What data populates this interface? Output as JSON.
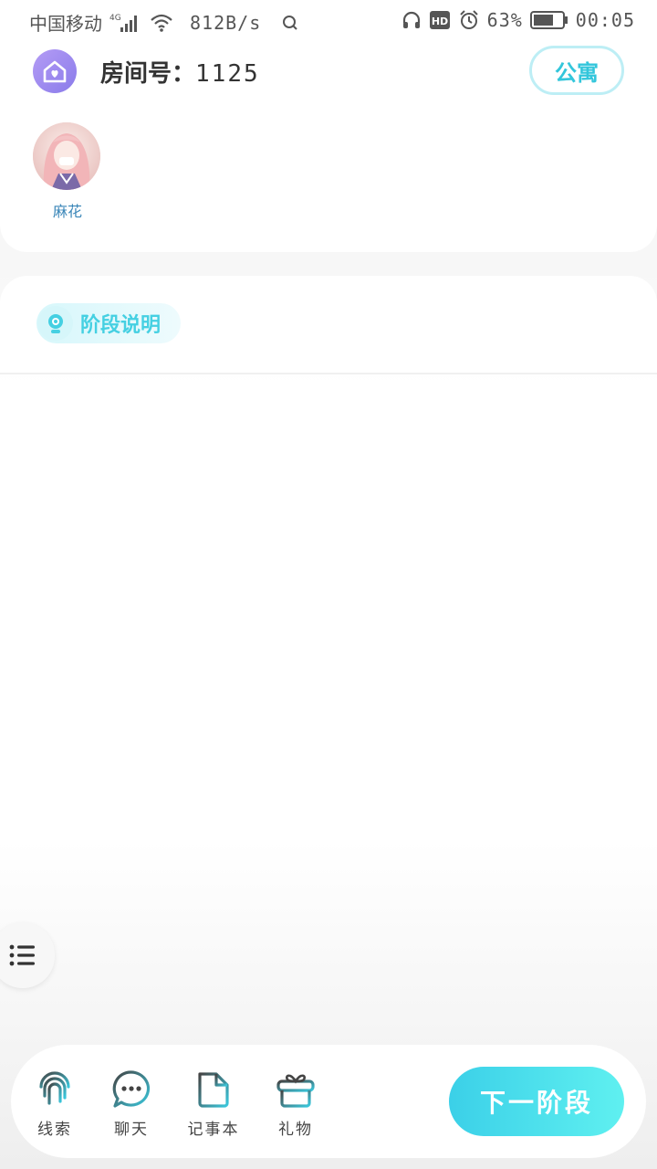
{
  "status_bar": {
    "carrier": "中国移动",
    "network": "4G",
    "speed": "812B/s",
    "battery": "63%",
    "time": "00:05"
  },
  "header": {
    "room_label": "房间号：",
    "room_number": "1125",
    "apartment_button": "公寓"
  },
  "players": [
    {
      "name": "麻花"
    }
  ],
  "stage": {
    "label": "阶段说明"
  },
  "bottom_nav": {
    "items": [
      {
        "label": "线索",
        "icon": "fingerprint-icon"
      },
      {
        "label": "聊天",
        "icon": "chat-icon"
      },
      {
        "label": "记事本",
        "icon": "notebook-icon"
      },
      {
        "label": "礼物",
        "icon": "gift-icon"
      }
    ],
    "next_button": "下一阶段"
  },
  "colors": {
    "accent": "#3bd0e8",
    "accent_light": "#5ff0f0",
    "home_icon": "#9b86f0",
    "name_text": "#3a86b8"
  }
}
